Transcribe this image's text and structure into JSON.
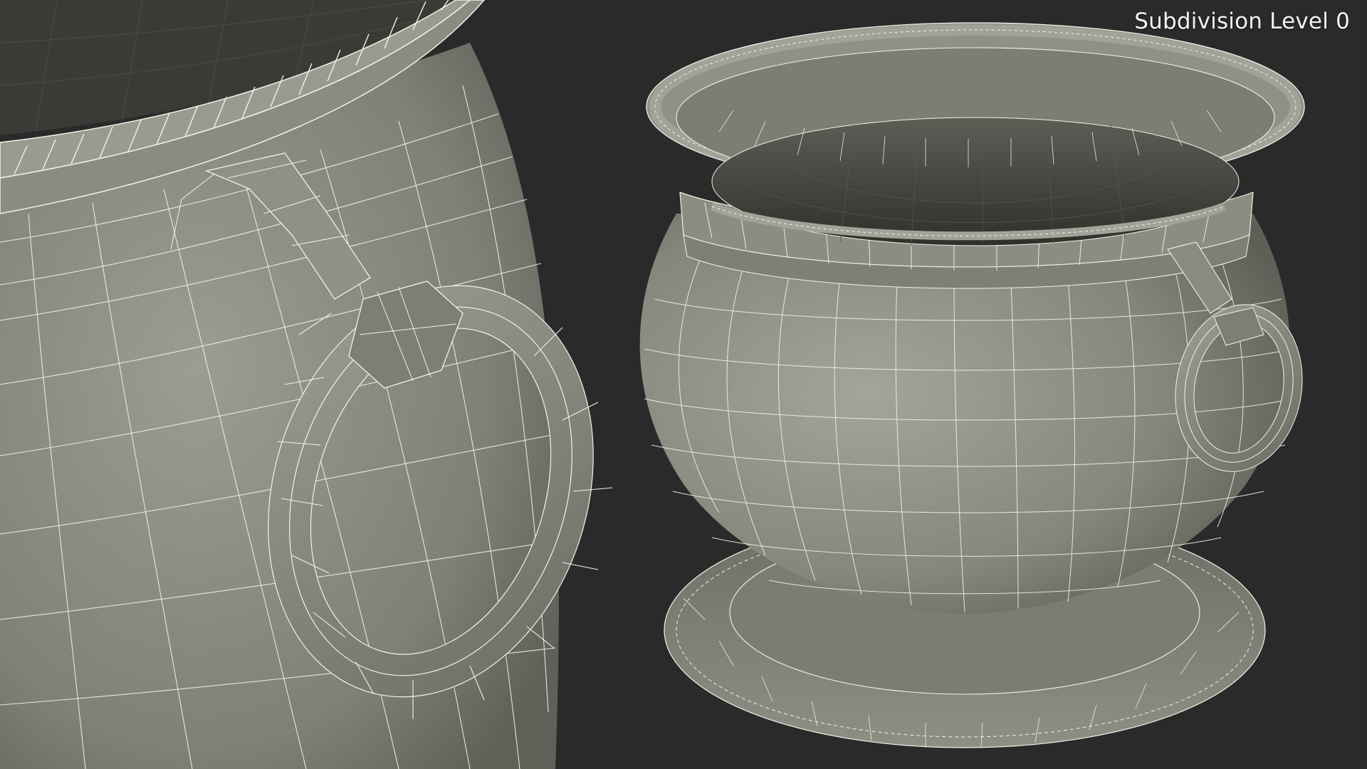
{
  "viewport": {
    "label": "Subdivision Level 0",
    "background_color": "#2a2a2a",
    "mesh_fill_color": "#8a8b80",
    "wire_color": "#f4f1e8"
  },
  "render": {
    "left_view": "closeup-of-pot-handle-ring",
    "right_view": "full-pot-with-base-and-ring-handle"
  }
}
